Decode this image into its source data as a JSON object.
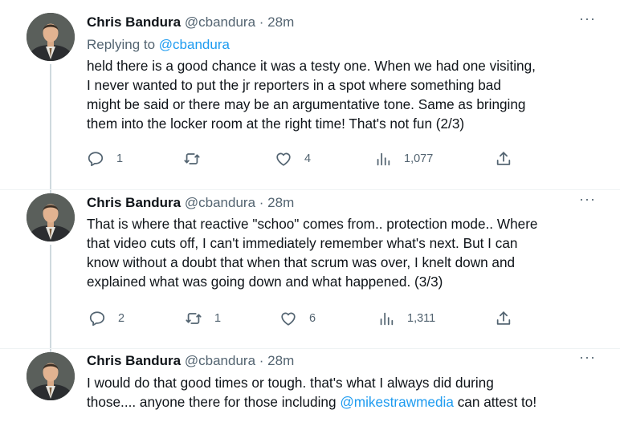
{
  "tweets": [
    {
      "name": "Chris Bandura",
      "handle": "@cbandura",
      "dot": "·",
      "time": "28m",
      "replying_prefix": "Replying to",
      "replying_to": "@cbandura",
      "lines": [
        "held there is a good chance it was a testy one.  When we had one visiting,",
        "I never wanted to put the jr reporters in a spot where something bad",
        "might be said or there may be an argumentative tone. Same as bringing",
        "them into the locker room at the right time! That's not fun (2/3)"
      ],
      "replies": "1",
      "retweets": "",
      "likes": "4",
      "views": "1,077"
    },
    {
      "name": "Chris Bandura",
      "handle": "@cbandura",
      "dot": "·",
      "time": "28m",
      "lines": [
        "That is where that reactive \"schoo\" comes from.. protection mode.. Where",
        "that video cuts off, I can't immediately remember what's next. But I can",
        "know without a doubt that when that scrum was over, I knelt down and",
        "explained what was going down and what happened. (3/3)"
      ],
      "replies": "2",
      "retweets": "1",
      "likes": "6",
      "views": "1,311"
    },
    {
      "name": "Chris Bandura",
      "handle": "@cbandura",
      "dot": "·",
      "time": "28m",
      "line1": "I would do that good times or tough. that's what I always did during",
      "line2_pre": "those.... anyone there for those including ",
      "line2_mention": "@mikestrawmedia",
      "line2_post": " can attest to!"
    }
  ],
  "more_glyph": "···",
  "icons": {
    "reply": "reply-icon",
    "retweet": "retweet-icon",
    "like": "heart-icon",
    "views": "views-icon",
    "share": "share-icon",
    "more": "more-icon"
  },
  "colors": {
    "link": "#1d9bf0",
    "secondary": "#536471",
    "text": "#0f1419",
    "thread_line": "#cfd9de"
  }
}
